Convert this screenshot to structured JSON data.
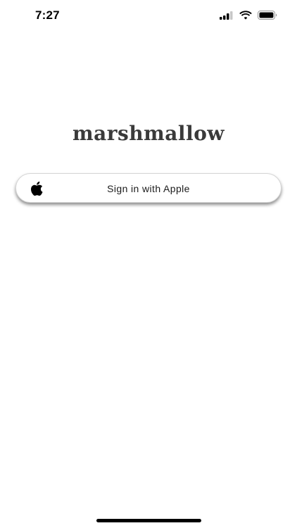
{
  "status_bar": {
    "time": "7:27",
    "icons": [
      "signal-icon",
      "wifi-icon",
      "battery-icon"
    ]
  },
  "app": {
    "title": "marshmallow",
    "title_color": "#3a3a3a"
  },
  "sign_in_button": {
    "label": "Sign in with Apple",
    "icon": "apple-logo-icon"
  }
}
